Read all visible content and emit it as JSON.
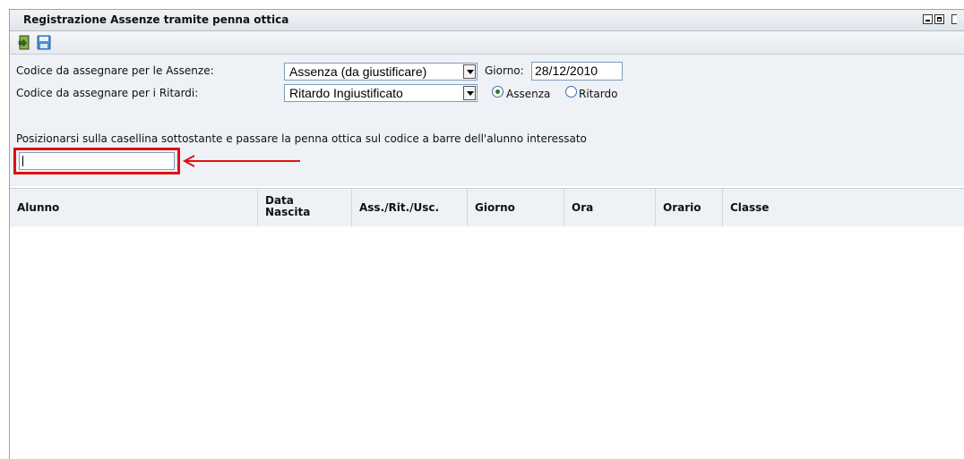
{
  "window": {
    "title": "Registrazione Assenze tramite penna ottica"
  },
  "toolbar": {
    "buttons": [
      {
        "icon": "exit-door-icon"
      },
      {
        "icon": "save-disk-icon"
      }
    ]
  },
  "form": {
    "absence_code_label": "Codice da assegnare per le Assenze:",
    "absence_code_value": "Assenza (da giustificare)",
    "date_label": "Giorno:",
    "date_value": "28/12/2010",
    "delay_code_label": "Codice da assegnare per i Ritardi:",
    "delay_code_value": "Ritardo Ingiustificato",
    "radio_absence_label": "Assenza",
    "radio_delay_label": "Ritardo",
    "radio_selected": "Assenza",
    "instruction": "Posizionarsi sulla casellina sottostante e passare la penna ottica sul codice a barre dell'alunno interessato",
    "barcode_value": ""
  },
  "grid": {
    "columns": [
      "Alunno",
      "Data\nNascita",
      "Ass./Rit./Usc.",
      "Giorno",
      "Ora",
      "Orario",
      "Classe"
    ],
    "rows": []
  },
  "colors": {
    "highlight": "#e01010",
    "header_bg": "#eef1f5"
  }
}
